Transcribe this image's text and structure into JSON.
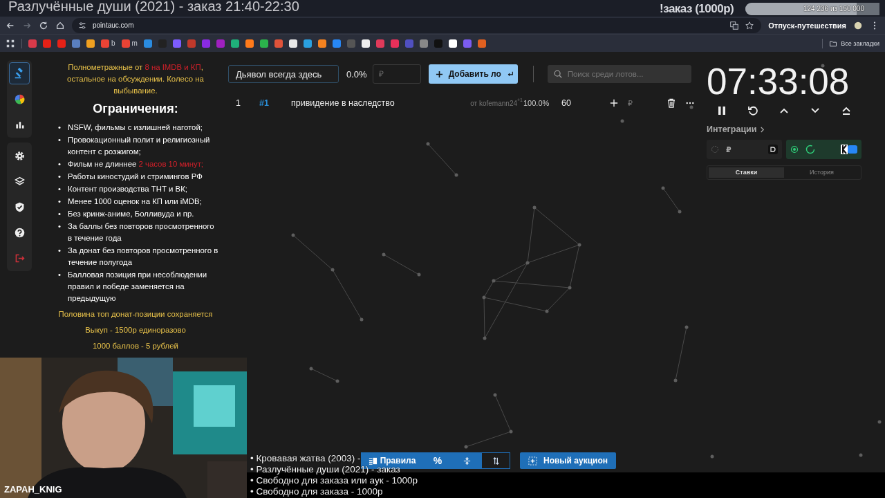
{
  "stream_overlay": {
    "title": "Разлучённые души (2021) - заказ 21:40-22:30",
    "order_label": "!заказ (1000р)",
    "goal": {
      "reading": "124 236  из 150 000",
      "level": 0.83
    },
    "goal_name": "Отпуск-путешествия",
    "streamer": "ZAPAH_KNIG",
    "queue": [
      "• Кровавая жатва (2003) -",
      "• Разлучённые души (2021) - заказ",
      "• Свободно для заказа или аук - 1000р",
      "• Свободно для заказа - 1000р"
    ]
  },
  "browser": {
    "address": "pointauc.com",
    "all_bookmarks": "Все закладки",
    "bookmarks": [
      {
        "color": "#d93a4a"
      },
      {
        "color": "#e62117"
      },
      {
        "color": "#e62117"
      },
      {
        "color": "#5a7fbf"
      },
      {
        "color": "#f0a020"
      },
      {
        "color": "#ea4335",
        "label": "b"
      },
      {
        "color": "#ea4335",
        "label": "m"
      },
      {
        "color": "#2a8be0"
      },
      {
        "color": "#222222"
      },
      {
        "color": "#7c5cff"
      },
      {
        "color": "#c0392b"
      },
      {
        "color": "#8a2be2"
      },
      {
        "color": "#a020c0"
      },
      {
        "color": "#1fb07a"
      },
      {
        "color": "#ff7a1a"
      },
      {
        "color": "#2bb24c"
      },
      {
        "color": "#e0533a"
      },
      {
        "color": "#e8e8e8"
      },
      {
        "color": "#2aa0e0"
      },
      {
        "color": "#f58220"
      },
      {
        "color": "#2787f5"
      },
      {
        "color": "#555555"
      },
      {
        "color": "#eeeeee"
      },
      {
        "color": "#e03a5a"
      },
      {
        "color": "#e8305a"
      },
      {
        "color": "#5050c0"
      },
      {
        "color": "#888888"
      },
      {
        "color": "#111111"
      },
      {
        "color": "#ffffff"
      },
      {
        "color": "#7b5cf0"
      },
      {
        "color": "#e06020"
      }
    ]
  },
  "sidebar": {
    "groups": [
      [
        {
          "kind": "gavel",
          "selected": true
        },
        {
          "kind": "pie",
          "selected": false
        },
        {
          "kind": "stats",
          "selected": false
        }
      ],
      [
        {
          "kind": "settings",
          "selected": false
        },
        {
          "kind": "layers",
          "selected": false
        },
        {
          "kind": "shield",
          "selected": false
        },
        {
          "kind": "help",
          "selected": false
        },
        {
          "kind": "logout",
          "selected": false
        }
      ]
    ]
  },
  "rules": {
    "intro": [
      {
        "text": "Полнометражные от ",
        "kind": "normal"
      },
      {
        "text": "8 на IMDB и КП",
        "kind": "accent"
      },
      {
        "text": ", остальное на обсуждении. Колесо на выбывание.",
        "kind": "normal"
      }
    ],
    "heading": "Ограничения:",
    "items": [
      {
        "marker": "•",
        "parts": [
          {
            "text": "NSFW, фильмы с излишней наготой;",
            "kind": "normal"
          }
        ]
      },
      {
        "marker": "•",
        "parts": [
          {
            "text": "Провокационный полит и религиозный контент с розжигом;",
            "kind": "normal"
          }
        ]
      },
      {
        "marker": "•",
        "parts": [
          {
            "text": "Фильм не длиннее ",
            "kind": "normal"
          },
          {
            "text": "2 часов 10 минут;",
            "kind": "accent"
          }
        ]
      },
      {
        "marker": "•",
        "parts": [
          {
            "text": "Работы киностудий и стримингов РФ",
            "kind": "normal"
          }
        ]
      },
      {
        "marker": "•",
        "parts": [
          {
            "text": "Контент производства ТНТ и ВК;",
            "kind": "normal"
          }
        ]
      },
      {
        "marker": "•",
        "parts": [
          {
            "text": "Менее 1000 оценок на КП или iMDB;",
            "kind": "normal"
          }
        ]
      },
      {
        "marker": "•",
        "parts": [
          {
            "text": "Без кринж-аниме, Болливуда и пр.",
            "kind": "normal"
          }
        ]
      },
      {
        "marker": "•",
        "parts": [
          {
            "text": "За баллы без повторов просмотренного в течение года",
            "kind": "normal"
          }
        ]
      },
      {
        "marker": "•",
        "parts": [
          {
            "text": "За донат без повторов просмотренного в течение полугода",
            "kind": "normal"
          }
        ]
      },
      {
        "marker": "•",
        "parts": [
          {
            "text": "Балловая позиция при несоблюдении правил и победе заменяется на предыдущую",
            "kind": "normal"
          }
        ]
      }
    ],
    "footer": [
      "Половина топ донат-позиции сохраняется",
      "Выкуп - 1500р единоразово",
      "1000 баллов - 5 рублей"
    ]
  },
  "lot_form": {
    "name": "Дьявол всегда здесь",
    "percent": "0.0%",
    "amount_placeholder": "₽",
    "add_button": "Добавить ло",
    "search_placeholder": "Поиск среди лотов..."
  },
  "lots": [
    {
      "index": "1",
      "id": "#1",
      "name": "привидение в наследство",
      "author": "от kofemann24",
      "bonus": "+1",
      "share": "100.0%",
      "amount": "60",
      "currency": "₽"
    }
  ],
  "timer": {
    "time": "07:33:08"
  },
  "integrations": {
    "title": "Интеграции",
    "items": [
      {
        "kind": "donation",
        "on": false,
        "currency": "₽"
      },
      {
        "kind": "vk",
        "on": true
      }
    ]
  },
  "history_tabs": [
    {
      "label": "Ставки",
      "selected": true
    },
    {
      "label": "История",
      "selected": false
    }
  ],
  "toolbar": [
    {
      "kind": "rules",
      "label": "Правила",
      "selected": false
    },
    {
      "kind": "percent",
      "label": "%",
      "selected": false
    },
    {
      "kind": "compress",
      "selected": false
    },
    {
      "kind": "sort",
      "selected": true
    }
  ],
  "new_auction": "Новый аукцион"
}
